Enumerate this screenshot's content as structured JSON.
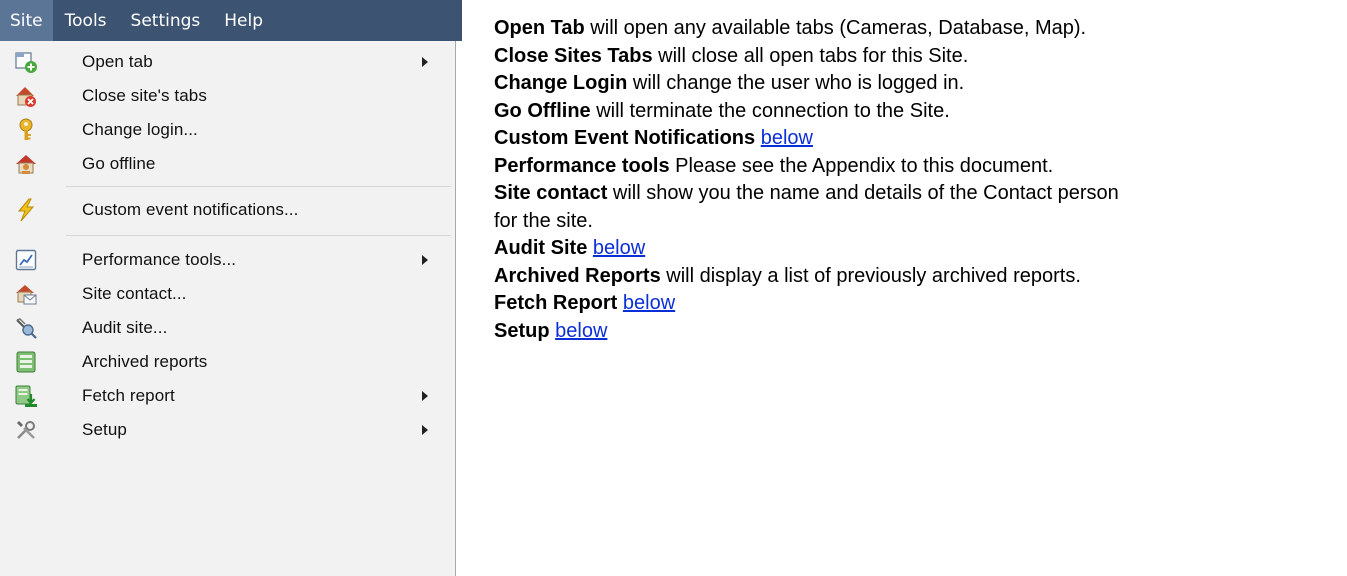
{
  "menubar": {
    "items": [
      {
        "label": "Site"
      },
      {
        "label": "Tools"
      },
      {
        "label": "Settings"
      },
      {
        "label": "Help"
      }
    ]
  },
  "dropdown": {
    "items": [
      {
        "label": "Open tab",
        "icon": "open-tab-icon"
      },
      {
        "label": "Close site's tabs",
        "icon": "close-tabs-icon"
      },
      {
        "label": "Change login...",
        "icon": "key-icon"
      },
      {
        "label": "Go offline",
        "icon": "go-offline-icon"
      },
      {
        "label": "Custom event notifications...",
        "icon": "lightning-icon"
      },
      {
        "label": "Performance tools...",
        "icon": "chart-icon"
      },
      {
        "label": "Site contact...",
        "icon": "site-contact-icon"
      },
      {
        "label": "Audit site...",
        "icon": "audit-icon"
      },
      {
        "label": "Archived reports",
        "icon": "archive-icon"
      },
      {
        "label": "Fetch report",
        "icon": "fetch-report-icon"
      },
      {
        "label": "Setup",
        "icon": "setup-tools-icon"
      }
    ]
  },
  "description": {
    "open_tab": {
      "term": "Open Tab",
      "text": " will open any available tabs (Cameras, Database, Map)."
    },
    "close_tabs": {
      "term": "Close Sites Tabs",
      "text": " will close all open tabs for this Site."
    },
    "change_login": {
      "term": "Change Login",
      "text": " will change the user who is logged in."
    },
    "go_offline": {
      "term": "Go Offline",
      "text": " will terminate the connection to the Site."
    },
    "custom_event": {
      "term": "Custom Event Notifications",
      "link": "below"
    },
    "performance": {
      "term": "Performance tools",
      "text": " Please see the Appendix to this document."
    },
    "site_contact": {
      "term": "Site contact",
      "text": " will show you the name and details of the Contact person",
      "text2": "for the site."
    },
    "audit_site": {
      "term": "Audit Site",
      "link": "below"
    },
    "archived": {
      "term": "Archived Reports",
      "text": " will display a list of previously archived reports."
    },
    "fetch_report": {
      "term": "Fetch Report",
      "link": "below"
    },
    "setup": {
      "term": "Setup",
      "link": "below"
    }
  }
}
